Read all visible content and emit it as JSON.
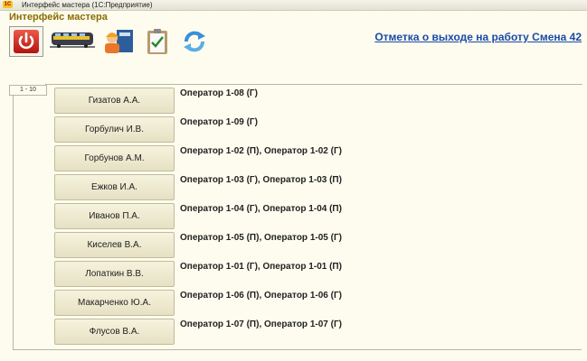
{
  "window": {
    "title": "Интерфейс мастера  (1С:Предприятие)",
    "app_icon": "1С"
  },
  "panel": {
    "title": "Интерфейс мастера"
  },
  "toolbar": [
    {
      "name": "power-icon"
    },
    {
      "name": "train-icon"
    },
    {
      "name": "worker-book-icon"
    },
    {
      "name": "clipboard-check-icon"
    },
    {
      "name": "refresh-icon"
    }
  ],
  "header_link": "Отметка о выходе на работу   Смена 42",
  "page_range": "1 - 10",
  "rows": [
    {
      "name": "Гизатов А.А.",
      "assignment": "Оператор 1-08 (Г)"
    },
    {
      "name": "Горбулич И.В.",
      "assignment": "Оператор 1-09 (Г)"
    },
    {
      "name": "Горбунов А.М.",
      "assignment": "Оператор 1-02 (П), Оператор 1-02 (Г)"
    },
    {
      "name": "Ежков И.А.",
      "assignment": "Оператор 1-03 (Г), Оператор 1-03 (П)"
    },
    {
      "name": "Иванов П.А.",
      "assignment": "Оператор 1-04 (Г), Оператор 1-04 (П)"
    },
    {
      "name": "Киселев В.А.",
      "assignment": "Оператор 1-05 (П), Оператор 1-05 (Г)"
    },
    {
      "name": "Лопаткин В.В.",
      "assignment": "Оператор 1-01 (Г), Оператор 1-01 (П)"
    },
    {
      "name": "Макарченко Ю.А.",
      "assignment": "Оператор 1-06 (П), Оператор 1-06 (Г)"
    },
    {
      "name": "Флусов В.А.",
      "assignment": "Оператор 1-07 (П), Оператор 1-07 (Г)"
    }
  ]
}
